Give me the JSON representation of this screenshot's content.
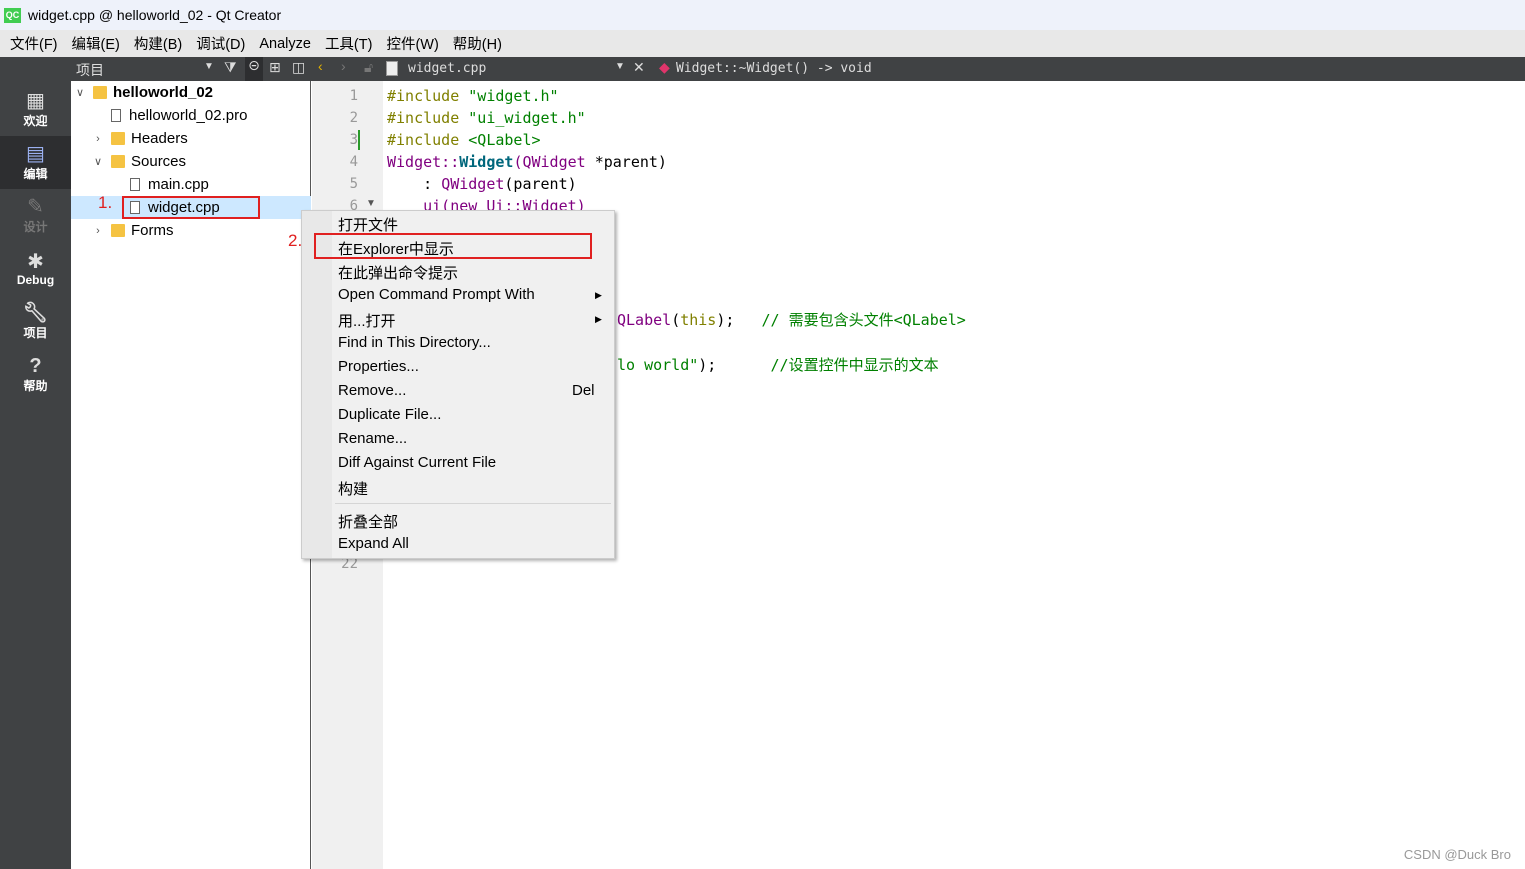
{
  "window": {
    "title": "widget.cpp @ helloworld_02 - Qt Creator",
    "logo": "QC"
  },
  "menubar": [
    "文件(F)",
    "编辑(E)",
    "构建(B)",
    "调试(D)",
    "Analyze",
    "工具(T)",
    "控件(W)",
    "帮助(H)"
  ],
  "toolbar": {
    "panel_title": "项目",
    "file_name": "widget.cpp",
    "symbol": "Widget::~Widget() -> void"
  },
  "modes": [
    {
      "label": "欢迎",
      "icon": "grid-icon"
    },
    {
      "label": "编辑",
      "icon": "edit-icon",
      "active": true
    },
    {
      "label": "设计",
      "icon": "pencil-icon",
      "disabled": true
    },
    {
      "label": "Debug",
      "icon": "bug-icon"
    },
    {
      "label": "项目",
      "icon": "wrench-icon"
    },
    {
      "label": "帮助",
      "icon": "help-icon"
    }
  ],
  "tree": {
    "project": "helloworld_02",
    "pro": "helloworld_02.pro",
    "headers": "Headers",
    "sources": "Sources",
    "main": "main.cpp",
    "widget": "widget.cpp",
    "forms": "Forms"
  },
  "code": {
    "line_numbers": [
      "1",
      "2",
      "3",
      "4",
      "5",
      "6",
      "22"
    ],
    "l1a": "#include ",
    "l1b": "\"widget.h\"",
    "l2a": "#include ",
    "l2b": "\"ui_widget.h\"",
    "l3a": "#include ",
    "l3b": "<QLabel>",
    "l4a": "Widget::",
    "l4b": "Widget",
    "l4c": "(QWidget ",
    "l4d": "*parent)",
    "l5a": "    : ",
    "l5b": "QWidget",
    "l5c": "(parent)",
    "l6": "    ui(new Ui::Widget)",
    "frag1a": "QLabel",
    "frag1b": "(",
    "frag1c": "this",
    "frag1d": ");",
    "frag1e": "// 需要包含头文件<QLabel>",
    "frag2a": "lo world\"",
    "frag2b": ");",
    "frag2c": "//设置控件中显示的文本"
  },
  "context_menu": {
    "items": [
      "打开文件",
      "在Explorer中显示",
      "在此弹出命令提示",
      "Open Command Prompt With",
      "用...打开",
      "Find in This Directory...",
      "Properties...",
      "Remove...",
      "Duplicate File...",
      "Rename...",
      "Diff Against Current File",
      "构建",
      "折叠全部",
      "Expand All"
    ],
    "remove_shortcut": "Del"
  },
  "annotations": {
    "step1": "1.",
    "step2": "2.",
    "color": "#e02020"
  },
  "watermark": "CSDN @Duck Bro"
}
